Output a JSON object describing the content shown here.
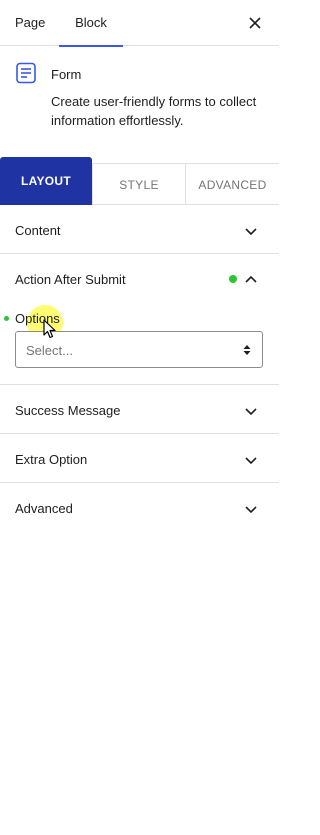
{
  "top_tabs": {
    "page": "Page",
    "block": "Block"
  },
  "block": {
    "title": "Form",
    "description": "Create user-friendly forms to collect information effortlessly."
  },
  "panel_tabs": {
    "layout": "LAYOUT",
    "style": "STYLE",
    "advanced": "ADVANCED"
  },
  "sections": {
    "content": "Content",
    "action_after_submit": "Action After Submit",
    "success_message": "Success Message",
    "extra_option": "Extra Option",
    "advanced": "Advanced"
  },
  "action": {
    "options_label": "Options",
    "select_placeholder": "Select..."
  },
  "colors": {
    "accent": "#3858e9",
    "layout_tab": "#1f33a3",
    "indicator_green": "#2ec52e"
  }
}
